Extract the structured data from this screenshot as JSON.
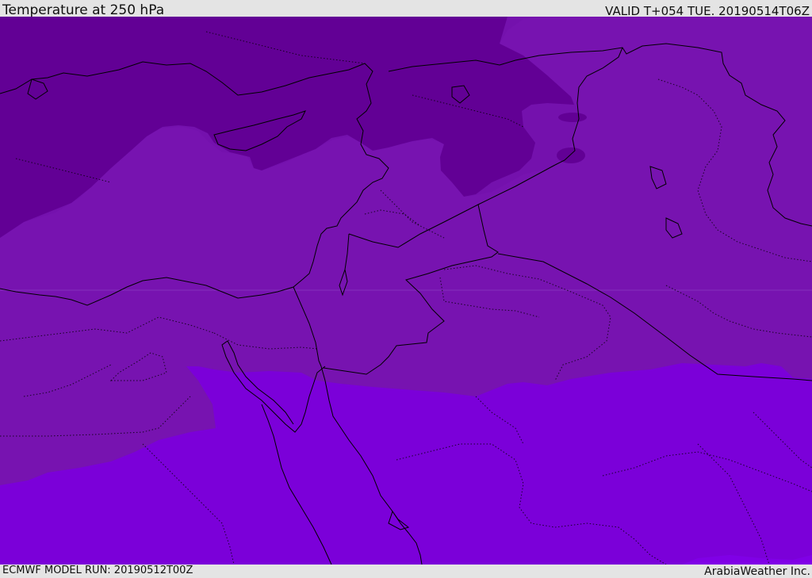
{
  "header": {
    "title": "Temperature at 250 hPa",
    "valid_time": "VALID T+054 TUE. 20190514T06Z"
  },
  "footer": {
    "model_run": "ECMWF MODEL RUN: 20190512T00Z",
    "credit": "ArabiaWeather Inc."
  },
  "map": {
    "field": "Temperature at 250 hPa",
    "colors": {
      "coldest": "#620095",
      "cold": "#7411ad",
      "mid": "#7713b0",
      "warm": "#7b00d9",
      "border": "#000000"
    }
  }
}
